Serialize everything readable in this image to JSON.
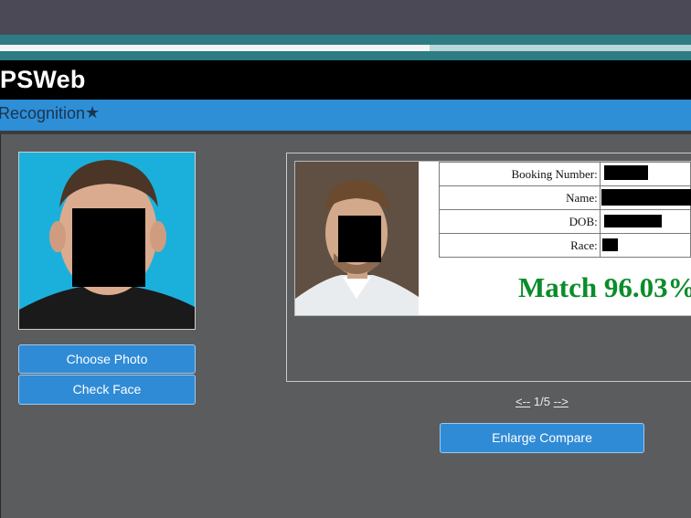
{
  "app": {
    "title": "PSWeb"
  },
  "nav": {
    "title": "Recognition",
    "star_icon": "star-icon"
  },
  "probe": {
    "choose_label": "Choose Photo",
    "check_label": "Check Face"
  },
  "result": {
    "fields": [
      {
        "label": "Booking Number:"
      },
      {
        "label": "Name:"
      },
      {
        "label": "DOB:"
      },
      {
        "label": "Race:"
      }
    ],
    "match_text": "Match 96.03%"
  },
  "pager": {
    "prev": "<--",
    "page": "1/5",
    "next": "-->"
  },
  "compare": {
    "enlarge_label": "Enlarge Compare"
  },
  "colors": {
    "accent_blue": "#2e8ed6",
    "match_green": "#0b8c2a",
    "background": "#5b5c5e",
    "teal_band": "#2d7c84"
  }
}
